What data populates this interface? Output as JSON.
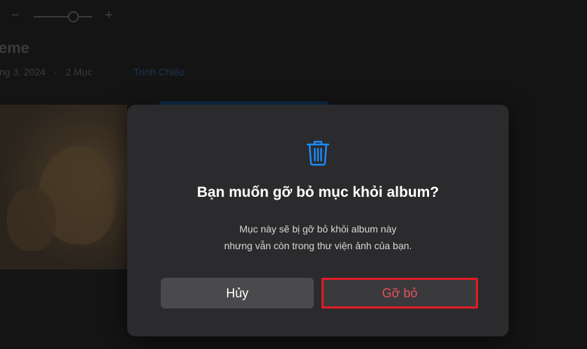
{
  "background": {
    "zoom": {
      "minus_label": "−",
      "plus_label": "+"
    },
    "album_title": "eme",
    "meta": {
      "date": "ng 3, 2024",
      "separator": "·",
      "count": "2 Mục"
    },
    "slideshow_label": "Trình Chiếu"
  },
  "dialog": {
    "icon": "trash-icon",
    "title": "Bạn muốn gỡ bỏ mục khỏi album?",
    "body_line1": "Mục này sẽ bị gỡ bỏ khỏi album này",
    "body_line2": "nhưng vẫn còn trong thư viện ảnh của bạn.",
    "cancel_label": "Hủy",
    "remove_label": "Gỡ bỏ"
  },
  "colors": {
    "dialog_bg": "#2b2b2d",
    "accent_icon": "#1a8cff",
    "remove_text": "#e4535b",
    "highlight_border": "#e21b26"
  }
}
